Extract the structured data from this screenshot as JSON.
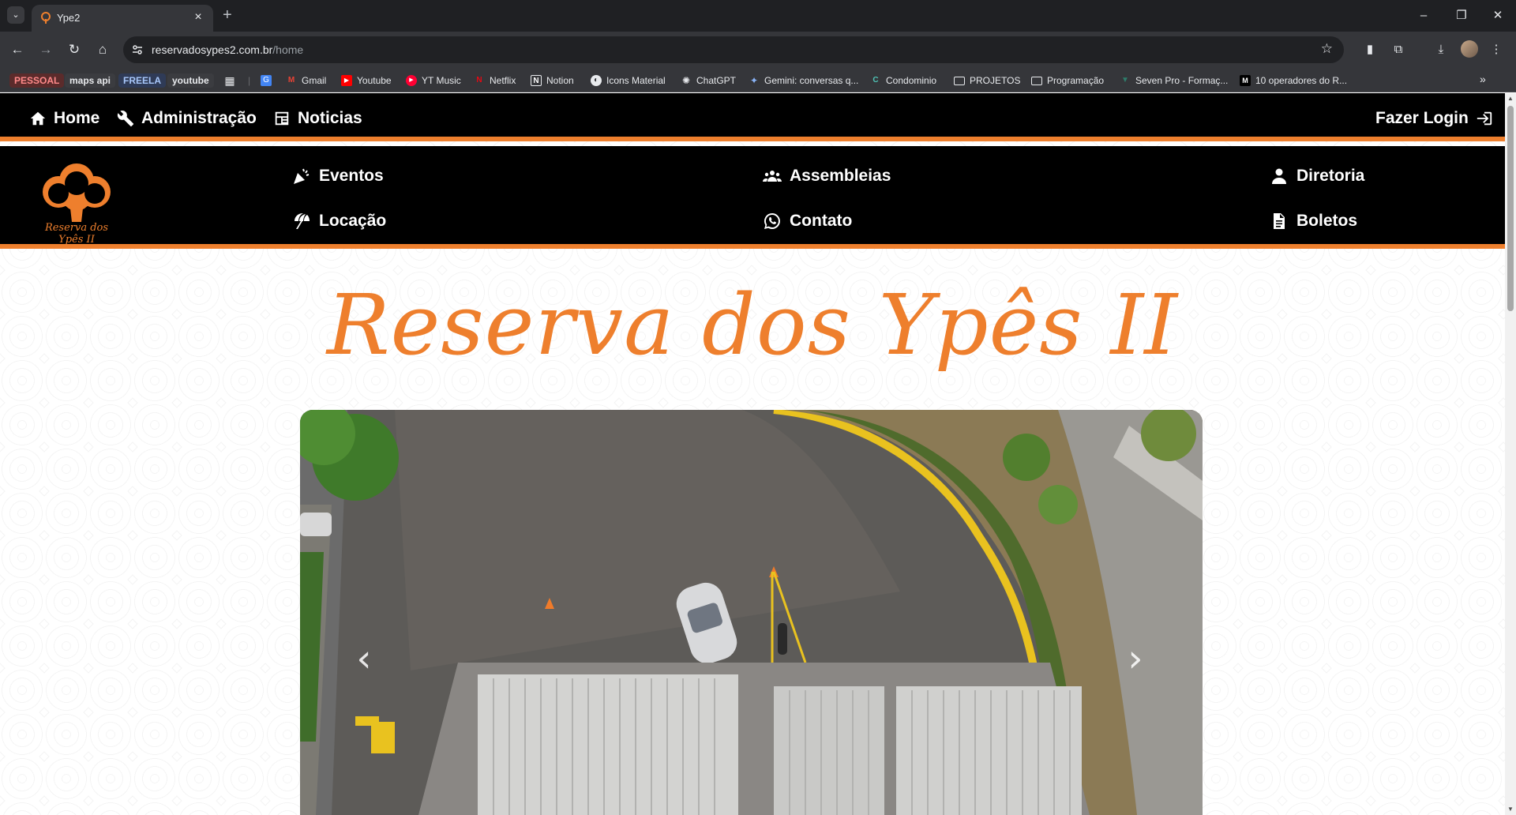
{
  "browser": {
    "tab_title": "Ype2",
    "url_domain": "reservadosypes2.com.br",
    "url_path": "/home",
    "bookmarks": [
      {
        "label": "PESSOAL",
        "color": "#e25d5d"
      },
      {
        "label": "maps api",
        "color": "#3b3c40"
      },
      {
        "label": "FREELA",
        "color": "#3c4a6b"
      },
      {
        "label": "youtube",
        "color": "#3b3c40"
      },
      {
        "label": "Gmail"
      },
      {
        "label": "Youtube"
      },
      {
        "label": "YT Music"
      },
      {
        "label": "Netflix"
      },
      {
        "label": "Notion"
      },
      {
        "label": "Icons Material"
      },
      {
        "label": "ChatGPT"
      },
      {
        "label": "Gemini: conversas q..."
      },
      {
        "label": "Condominio"
      },
      {
        "label": "PROJETOS"
      },
      {
        "label": "Programação"
      },
      {
        "label": "Seven Pro - Formaç..."
      },
      {
        "label": "10 operadores do R..."
      }
    ]
  },
  "topbar": {
    "home": "Home",
    "admin": "Administração",
    "news": "Noticias",
    "login": "Fazer Login"
  },
  "mainnav": {
    "logo_text": "Reserva dos Ypês II",
    "eventos": "Eventos",
    "assembleias": "Assembleias",
    "diretoria": "Diretoria",
    "locacao": "Locação",
    "contato": "Contato",
    "boletos": "Boletos"
  },
  "hero": {
    "title": "Reserva dos Ypês II"
  },
  "colors": {
    "accent": "#ee7f2d",
    "bar": "#000000"
  }
}
